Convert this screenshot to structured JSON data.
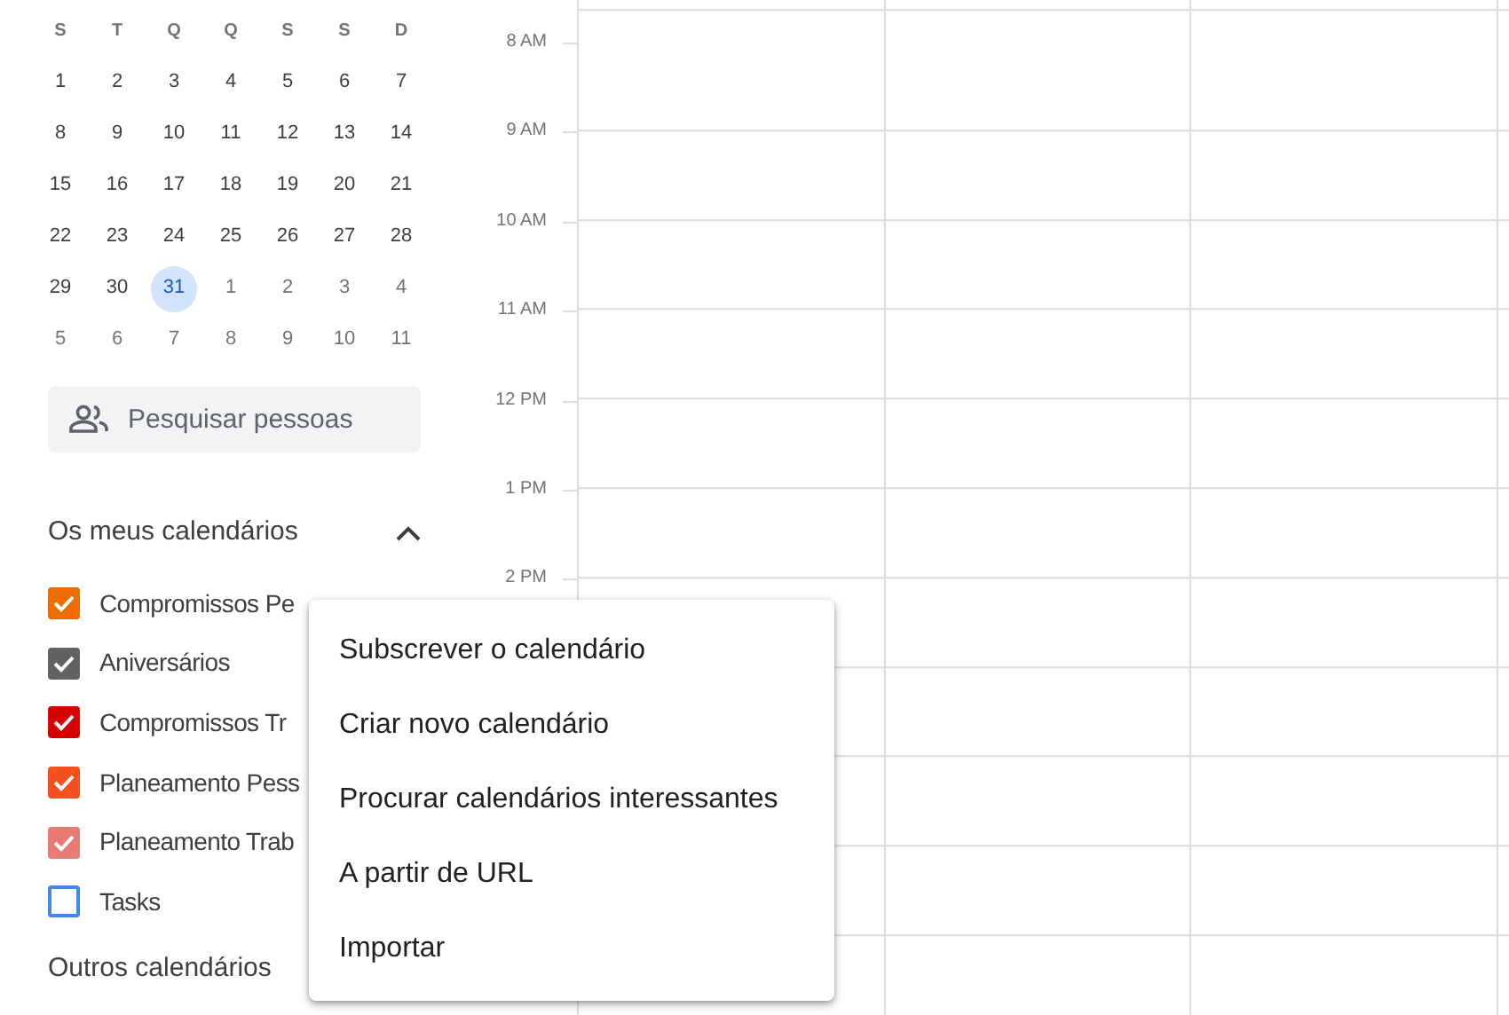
{
  "mini_calendar": {
    "weekdays": [
      "S",
      "T",
      "Q",
      "Q",
      "S",
      "S",
      "D"
    ],
    "weeks": [
      [
        {
          "label": "1",
          "other_month": false,
          "selected": false
        },
        {
          "label": "2",
          "other_month": false,
          "selected": false
        },
        {
          "label": "3",
          "other_month": false,
          "selected": false
        },
        {
          "label": "4",
          "other_month": false,
          "selected": false
        },
        {
          "label": "5",
          "other_month": false,
          "selected": false
        },
        {
          "label": "6",
          "other_month": false,
          "selected": false
        },
        {
          "label": "7",
          "other_month": false,
          "selected": false
        }
      ],
      [
        {
          "label": "8",
          "other_month": false,
          "selected": false
        },
        {
          "label": "9",
          "other_month": false,
          "selected": false
        },
        {
          "label": "10",
          "other_month": false,
          "selected": false
        },
        {
          "label": "11",
          "other_month": false,
          "selected": false
        },
        {
          "label": "12",
          "other_month": false,
          "selected": false
        },
        {
          "label": "13",
          "other_month": false,
          "selected": false
        },
        {
          "label": "14",
          "other_month": false,
          "selected": false
        }
      ],
      [
        {
          "label": "15",
          "other_month": false,
          "selected": false
        },
        {
          "label": "16",
          "other_month": false,
          "selected": false
        },
        {
          "label": "17",
          "other_month": false,
          "selected": false
        },
        {
          "label": "18",
          "other_month": false,
          "selected": false
        },
        {
          "label": "19",
          "other_month": false,
          "selected": false
        },
        {
          "label": "20",
          "other_month": false,
          "selected": false
        },
        {
          "label": "21",
          "other_month": false,
          "selected": false
        }
      ],
      [
        {
          "label": "22",
          "other_month": false,
          "selected": false
        },
        {
          "label": "23",
          "other_month": false,
          "selected": false
        },
        {
          "label": "24",
          "other_month": false,
          "selected": false
        },
        {
          "label": "25",
          "other_month": false,
          "selected": false
        },
        {
          "label": "26",
          "other_month": false,
          "selected": false
        },
        {
          "label": "27",
          "other_month": false,
          "selected": false
        },
        {
          "label": "28",
          "other_month": false,
          "selected": false
        }
      ],
      [
        {
          "label": "29",
          "other_month": false,
          "selected": false
        },
        {
          "label": "30",
          "other_month": false,
          "selected": false
        },
        {
          "label": "31",
          "other_month": false,
          "selected": true
        },
        {
          "label": "1",
          "other_month": true,
          "selected": false
        },
        {
          "label": "2",
          "other_month": true,
          "selected": false
        },
        {
          "label": "3",
          "other_month": true,
          "selected": false
        },
        {
          "label": "4",
          "other_month": true,
          "selected": false
        }
      ],
      [
        {
          "label": "5",
          "other_month": true,
          "selected": false
        },
        {
          "label": "6",
          "other_month": true,
          "selected": false
        },
        {
          "label": "7",
          "other_month": true,
          "selected": false
        },
        {
          "label": "8",
          "other_month": true,
          "selected": false
        },
        {
          "label": "9",
          "other_month": true,
          "selected": false
        },
        {
          "label": "10",
          "other_month": true,
          "selected": false
        },
        {
          "label": "11",
          "other_month": true,
          "selected": false
        }
      ]
    ]
  },
  "search": {
    "placeholder": "Pesquisar pessoas"
  },
  "my_calendars": {
    "title": "Os meus calendários",
    "expanded": true,
    "items": [
      {
        "label": "Compromissos Pe",
        "checked": true,
        "color": "#ef6c00"
      },
      {
        "label": "Aniversários",
        "checked": true,
        "color": "#616161"
      },
      {
        "label": "Compromissos Tr",
        "checked": true,
        "color": "#d50000"
      },
      {
        "label": "Planeamento Pess",
        "checked": true,
        "color": "#f4511e"
      },
      {
        "label": "Planeamento Trab",
        "checked": true,
        "color": "#e67c73"
      },
      {
        "label": "Tasks",
        "checked": false,
        "color": "#4285f4"
      }
    ]
  },
  "other_calendars": {
    "title": "Outros calendários"
  },
  "time_grid": {
    "hours": [
      "8 AM",
      "9 AM",
      "10 AM",
      "11 AM",
      "12 PM",
      "1 PM",
      "2 PM"
    ]
  },
  "menu": {
    "items": [
      "Subscrever o calendário",
      "Criar novo calendário",
      "Procurar calendários interessantes",
      "A partir de URL",
      "Importar"
    ]
  }
}
